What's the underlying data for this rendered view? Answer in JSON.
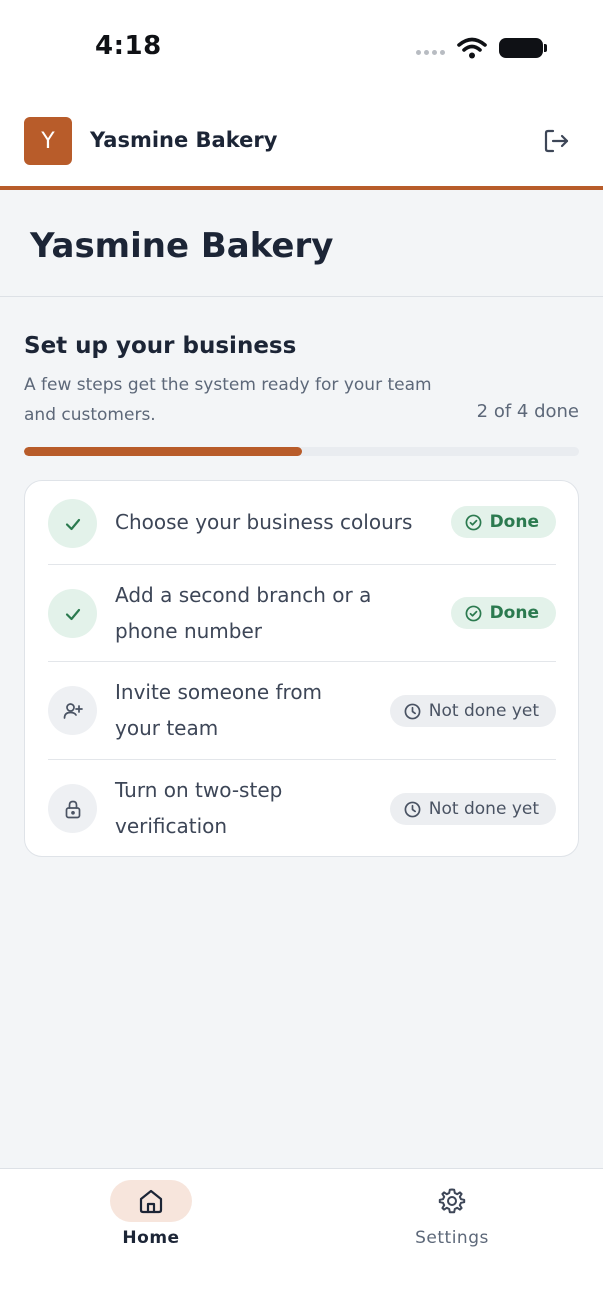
{
  "status_bar": {
    "time": "4:18",
    "icons": [
      "signal-dots-icon",
      "wifi-icon",
      "battery-icon"
    ]
  },
  "header": {
    "avatar_initial": "Y",
    "business_name": "Yasmine Bakery",
    "logout_icon": "logout-icon",
    "accent_color": "#b85c2a"
  },
  "page": {
    "title": "Yasmine Bakery"
  },
  "setup": {
    "title": "Set up your business",
    "description": "A few steps get the system ready for your team and customers.",
    "progress_text": "2 of 4 done",
    "progress_fraction": 0.5,
    "tasks": [
      {
        "label": "Choose your business colours",
        "status": "Done",
        "state": "done",
        "icon": "check-icon"
      },
      {
        "label": "Add a second branch or a phone number",
        "status": "Done",
        "state": "done",
        "icon": "check-icon"
      },
      {
        "label": "Invite someone from your team",
        "status": "Not done yet",
        "state": "pending",
        "icon": "user-plus-icon"
      },
      {
        "label": "Turn on two-step verification",
        "status": "Not done yet",
        "state": "pending",
        "icon": "lock-icon"
      }
    ]
  },
  "nav": {
    "items": [
      {
        "label": "Home",
        "icon": "home-icon",
        "active": true
      },
      {
        "label": "Settings",
        "icon": "gear-icon",
        "active": false
      }
    ]
  },
  "colors": {
    "accent": "#b85c2a",
    "done_bg": "#e3f2ea",
    "done_text": "#2b7a4f",
    "pending_bg": "#eceef1",
    "page_bg": "#f3f5f7"
  }
}
